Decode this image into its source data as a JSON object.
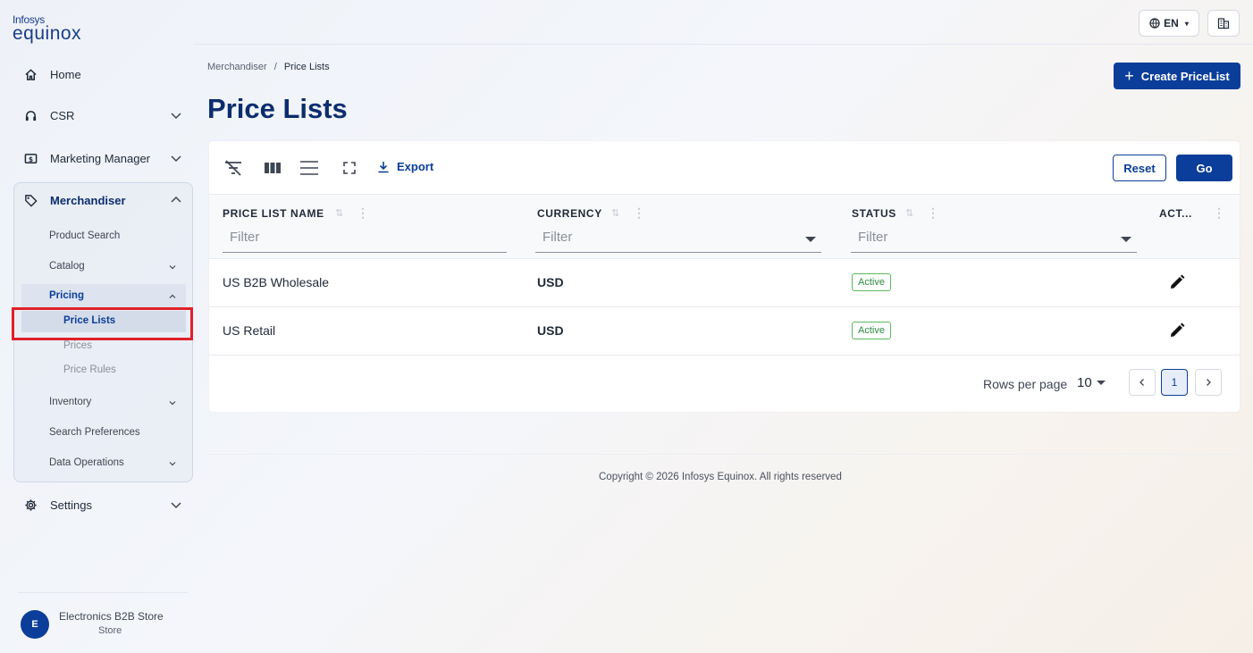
{
  "brand": {
    "line1": "Infosys",
    "line2": "equinox"
  },
  "nav": {
    "home": "Home",
    "csr": "CSR",
    "marketing": "Marketing Manager",
    "merchandiser": "Merchandiser",
    "settings": "Settings"
  },
  "merchandiser_sub": {
    "product_search": "Product Search",
    "catalog": "Catalog",
    "pricing": "Pricing",
    "price_lists": "Price Lists",
    "prices": "Prices",
    "price_rules": "Price Rules",
    "inventory": "Inventory",
    "search_prefs": "Search Preferences",
    "data_ops": "Data Operations"
  },
  "store": {
    "avatar": "E",
    "name": "Electronics B2B Store",
    "type": "Store"
  },
  "header": {
    "lang": "EN"
  },
  "breadcrumb": {
    "parent": "Merchandiser",
    "sep": "/",
    "current": "Price Lists"
  },
  "page": {
    "title": "Price Lists",
    "create_label": "Create PriceList"
  },
  "toolbar": {
    "export": "Export",
    "reset": "Reset",
    "go": "Go"
  },
  "table": {
    "columns": [
      {
        "label": "PRICE LIST NAME",
        "filter": "Filter"
      },
      {
        "label": "CURRENCY",
        "filter": "Filter"
      },
      {
        "label": "STATUS",
        "filter": "Filter"
      },
      {
        "label": "ACT..."
      }
    ],
    "rows": [
      {
        "name": "US B2B Wholesale",
        "currency": "USD",
        "status": "Active"
      },
      {
        "name": "US Retail",
        "currency": "USD",
        "status": "Active"
      }
    ]
  },
  "pagination": {
    "rows_label": "Rows per page",
    "rows_value": "10",
    "page": "1"
  },
  "footer": {
    "copyright": "Copyright © 2026 Infosys Equinox. All rights reserved"
  }
}
